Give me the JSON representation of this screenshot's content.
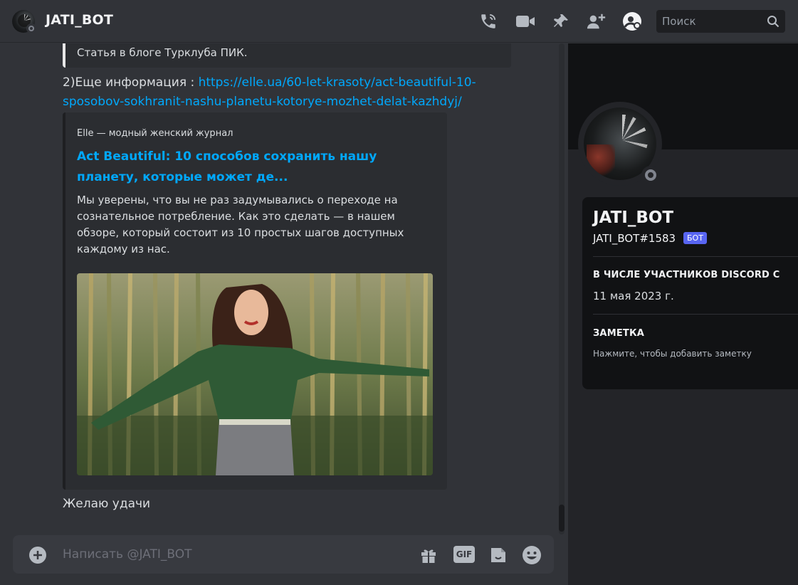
{
  "header": {
    "title": "JATI_BOT",
    "search_placeholder": "Поиск",
    "icons": [
      "call-icon",
      "video-icon",
      "pin-icon",
      "add-friend-icon",
      "profile-icon",
      "search-icon"
    ]
  },
  "chat": {
    "previous_embed_text": "Статья в блоге Турклуба ПИК.",
    "message_prefix": "2)Еще информация : ",
    "message_link": "https://elle.ua/60-let-krasoty/act-beautiful-10-sposobov-sokhranit-nashu-planetu-kotorye-mozhet-delat-kazhdyj/",
    "embed": {
      "provider": "Elle — модный женский журнал",
      "title": "Act Beautiful: 10 способов сохранить нашу планету, которые может де...",
      "description": "Мы уверены, что вы не раз задумывались о переходе на сознательное потребление. Как это сделать — в нашем обзоре, который состоит из 10 простых шагов доступных каждому из нас."
    },
    "last_message": "Желаю удачи"
  },
  "composer": {
    "placeholder": "Написать @JATI_BOT",
    "gif_label": "GIF",
    "icons": [
      "add-attachment-icon",
      "gift-icon",
      "gif-icon",
      "sticker-icon",
      "emoji-icon"
    ]
  },
  "profile": {
    "name": "JATI_BOT",
    "tag": "JATI_BOT#1583",
    "badge": "БОТ",
    "member_since_heading": "В ЧИСЛЕ УЧАСТНИКОВ DISCORD С",
    "member_since": "11 мая 2023 г.",
    "note_heading": "ЗАМЕТКА",
    "note_placeholder": "Нажмите, чтобы добавить заметку"
  },
  "colors": {
    "background": "#313338",
    "link": "#00a8fc",
    "badge": "#5865f2",
    "panel": "#232428",
    "card": "#111214"
  }
}
